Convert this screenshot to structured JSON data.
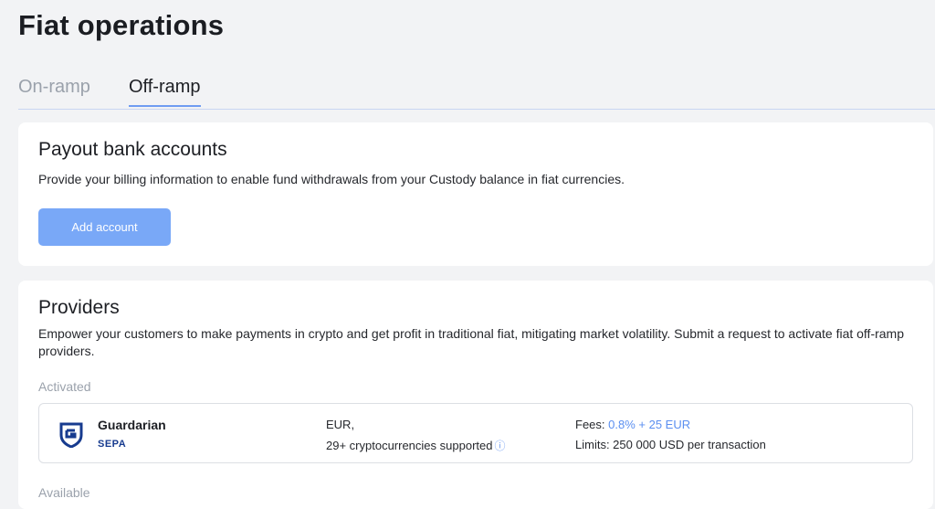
{
  "page": {
    "title": "Fiat operations"
  },
  "tabs": [
    {
      "label": "On-ramp",
      "active": false
    },
    {
      "label": "Off-ramp",
      "active": true
    }
  ],
  "payout": {
    "title": "Payout bank accounts",
    "description": "Provide your billing information to enable fund withdrawals from your Custody balance in fiat currencies.",
    "add_button": "Add account"
  },
  "providers": {
    "title": "Providers",
    "description": "Empower your customers to make payments in crypto and get profit in traditional fiat, mitigating market volatility. Submit a request to activate fiat off-ramp providers.",
    "activated_label": "Activated",
    "available_label": "Available",
    "items": [
      {
        "name": "Guardarian",
        "badge": "SEPA",
        "currencies": "EUR,",
        "crypto": "29+ cryptocurrencies supported",
        "fees_label": "Fees:",
        "fees_value": "0.8% + 25 EUR",
        "limits": "Limits: 250 000 USD per transaction"
      }
    ]
  },
  "colors": {
    "accent": "#6f9cf2",
    "button": "#79a8f7",
    "background": "#f2f3f5"
  }
}
